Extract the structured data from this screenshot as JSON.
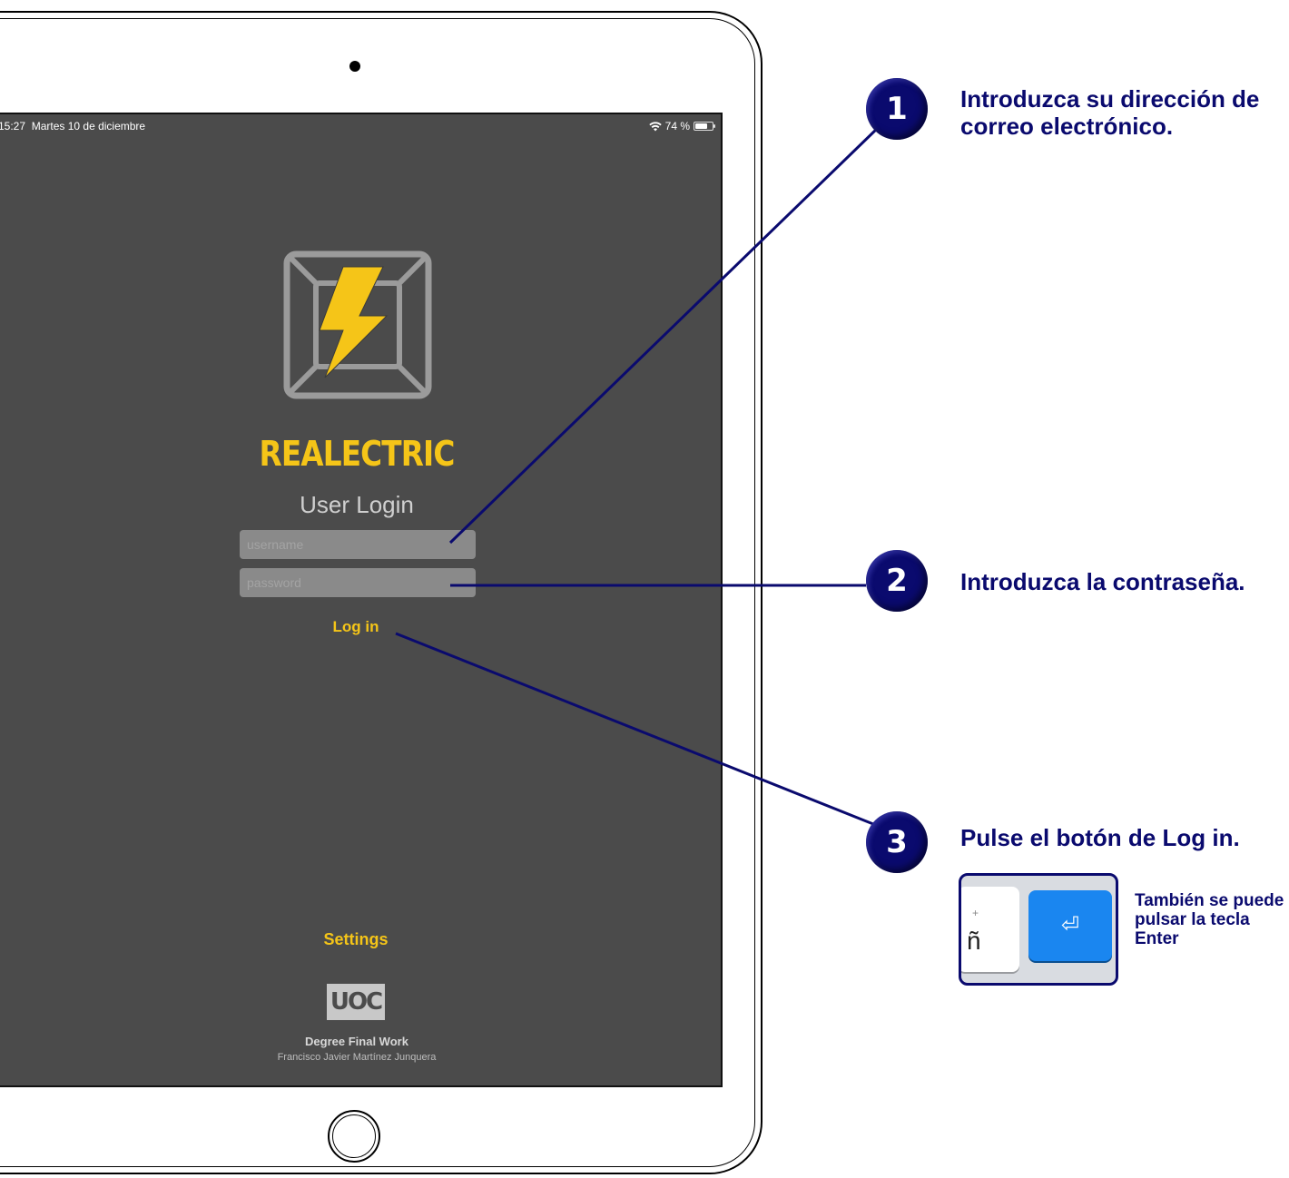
{
  "status_bar": {
    "time": "15:27",
    "date": "Martes 10 de diciembre",
    "battery": "74 %",
    "battery_level": 0.74,
    "wifi_icon": "wifi-icon"
  },
  "app": {
    "title": "REALECTRIC",
    "heading": "User Login",
    "username_placeholder": "username",
    "password_placeholder": "password",
    "login_label": "Log in",
    "settings_label": "Settings",
    "uoc_logo_text": "UOC",
    "degree": "Degree Final Work",
    "author": "Francisco Javier Martínez Junquera"
  },
  "annotations": {
    "steps": [
      {
        "number": "1",
        "text": "Introduzca su dirección de correo electrónico."
      },
      {
        "number": "2",
        "text": "Introduzca la contraseña."
      },
      {
        "number": "3",
        "text": "Pulse el botón de Log in."
      }
    ],
    "keyboard": {
      "key_label": "ñ",
      "key_secondary": "+",
      "enter_symbol": "⏎",
      "note_prefix": "También se puede pulsar la tecla",
      "note_key": "Enter"
    }
  },
  "colors": {
    "accent_yellow": "#f5c518",
    "annotation_navy": "#0a0a6e",
    "screen_bg": "#4b4b4b",
    "enter_key_blue": "#1a86f0"
  }
}
